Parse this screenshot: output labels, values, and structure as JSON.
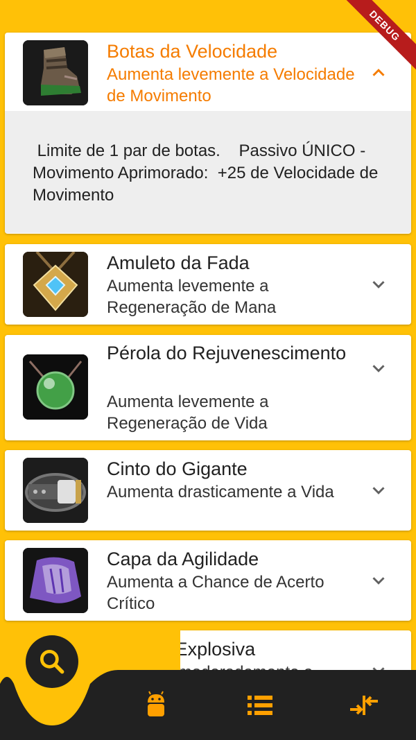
{
  "debug_banner": "DEBUG",
  "items": [
    {
      "title": "Botas da Velocidade",
      "subtitle": "Aumenta levemente a Velocidade de Movimento",
      "details": " Limite de 1 par de botas.    Passivo ÚNICO - Movimento Aprimorado:  +25 de Velocidade de Movimento",
      "expanded": true,
      "icon": "boots-icon"
    },
    {
      "title": "Amuleto da Fada",
      "subtitle": "Aumenta levemente a Regeneração de Mana",
      "expanded": false,
      "icon": "amulet-icon"
    },
    {
      "title": "Pérola do Rejuvenescimento",
      "subtitle": "Aumenta levemente a Regeneração de Vida",
      "expanded": false,
      "icon": "pearl-icon"
    },
    {
      "title": "Cinto do Gigante",
      "subtitle": "Aumenta drasticamente a Vida",
      "expanded": false,
      "icon": "belt-icon"
    },
    {
      "title": "Capa da Agilidade",
      "subtitle": "Aumenta a Chance de Acerto Crítico",
      "expanded": false,
      "icon": "cloak-icon"
    },
    {
      "title": "Varinha Explosiva",
      "subtitle": "Aumenta moderadamente a",
      "expanded": false,
      "icon": "wand-icon"
    }
  ],
  "bottom_nav": [
    {
      "icon": "search-icon",
      "active": true
    },
    {
      "icon": "android-icon",
      "active": false
    },
    {
      "icon": "list-icon",
      "active": false
    },
    {
      "icon": "compare-icon",
      "active": false
    }
  ],
  "colors": {
    "background": "#FFC107",
    "accent": "#F57C00",
    "nav_bar": "#212121"
  }
}
